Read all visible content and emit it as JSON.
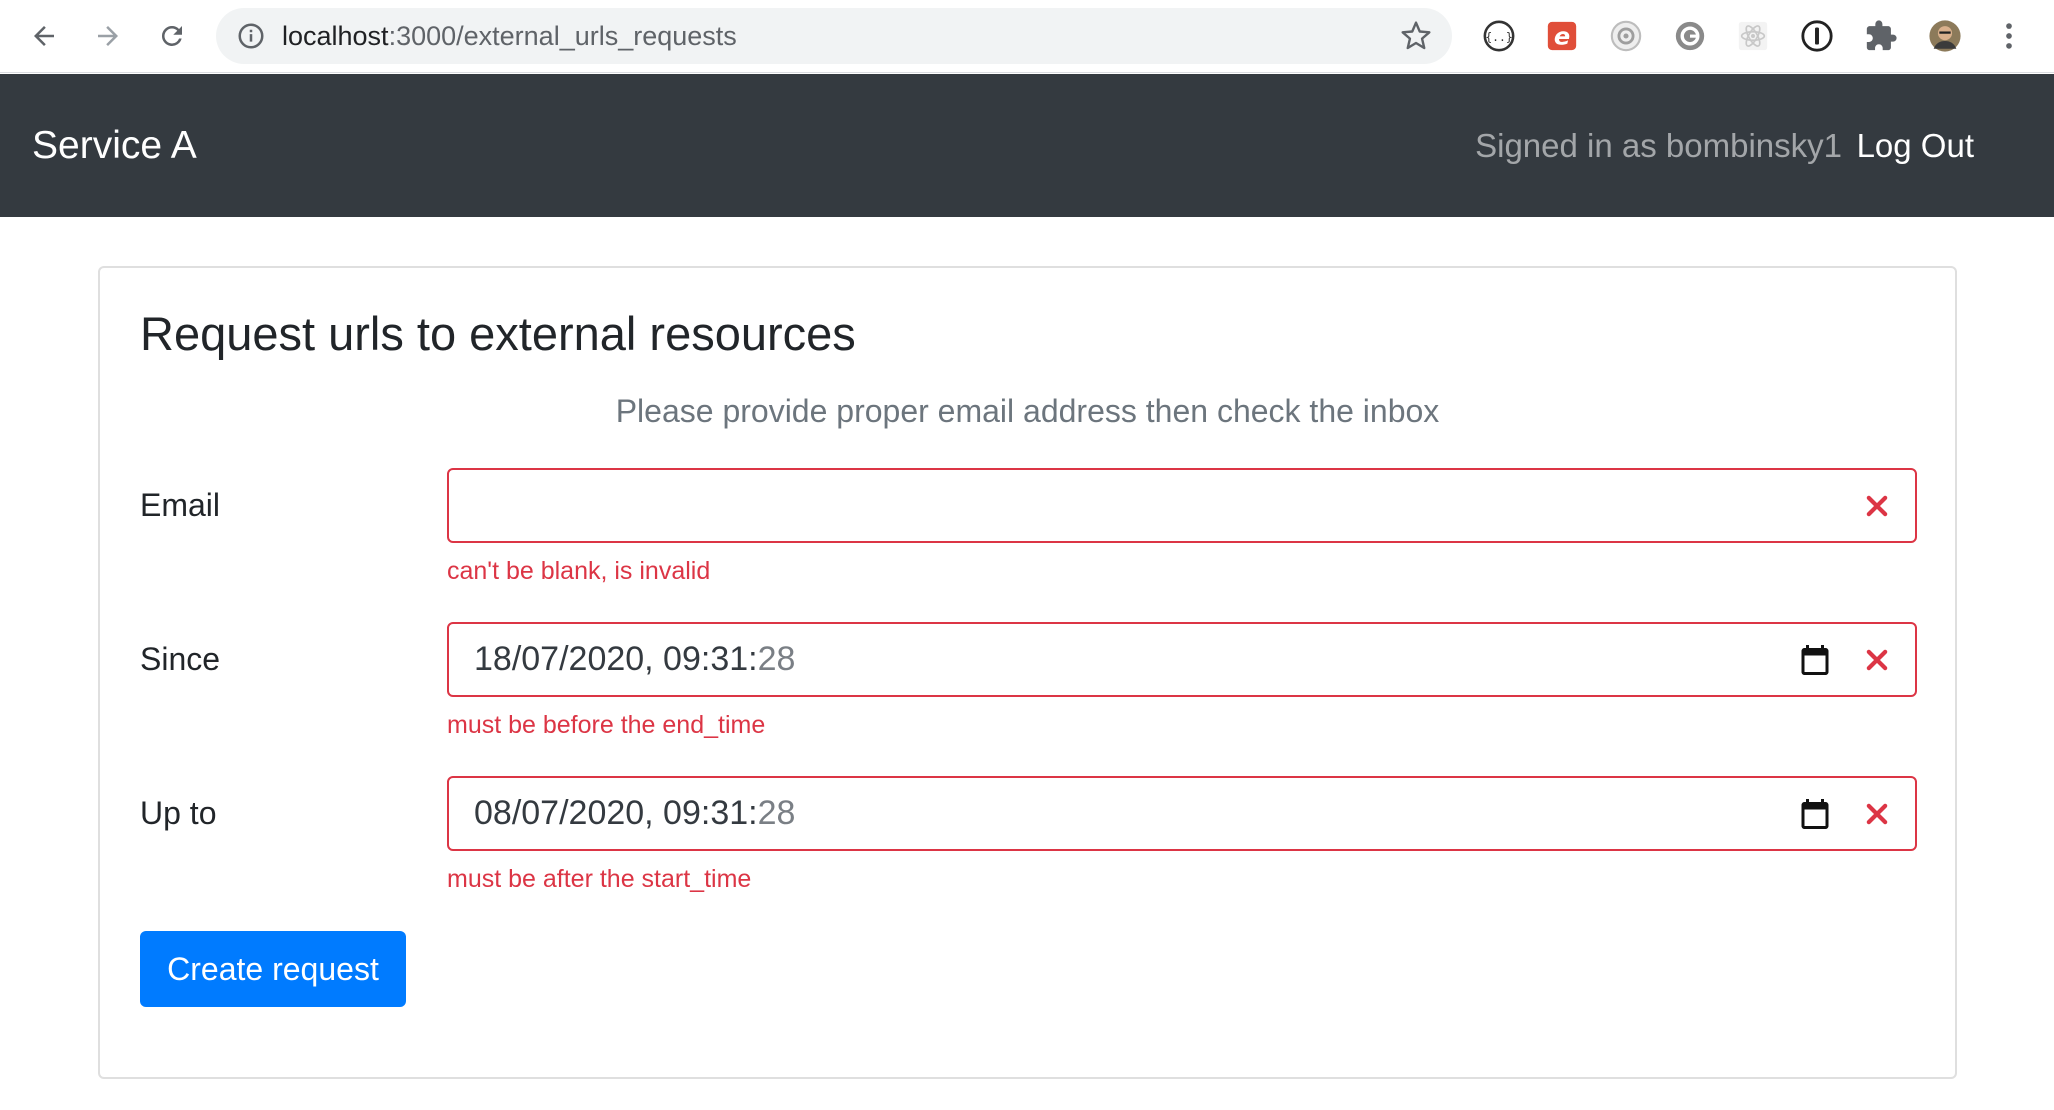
{
  "browser": {
    "url_host": "localhost",
    "url_path": ":3000/external_urls_requests",
    "icons": [
      "back-arrow-icon",
      "forward-arrow-icon",
      "reload-icon",
      "site-info-icon",
      "bookmark-star-icon",
      "json-viewer-extension-icon",
      "e-extension-icon",
      "target-extension-icon",
      "g-extension-icon",
      "react-devtools-extension-icon",
      "password-manager-extension-icon",
      "extensions-puzzle-icon",
      "profile-avatar",
      "more-menu-icon"
    ]
  },
  "navbar": {
    "brand": "Service A",
    "signed_in": "Signed in as bombinsky1",
    "logout": "Log Out"
  },
  "card": {
    "title": "Request urls to external resources",
    "subtitle": "Please provide proper email address then check the inbox"
  },
  "form": {
    "email": {
      "label": "Email",
      "value": "",
      "error": "can't be blank, is invalid"
    },
    "since": {
      "label": "Since",
      "value_main": "18/07/2020, 09:31:",
      "value_seconds": "28",
      "error": "must be before the end_time"
    },
    "upto": {
      "label": "Up to",
      "value_main": "08/07/2020, 09:31:",
      "value_seconds": "28",
      "error": "must be after the start_time"
    },
    "submit": "Create request"
  },
  "colors": {
    "navbar_bg": "#343a40",
    "danger": "#dc3545",
    "primary": "#007bff",
    "muted": "#6c757d"
  }
}
